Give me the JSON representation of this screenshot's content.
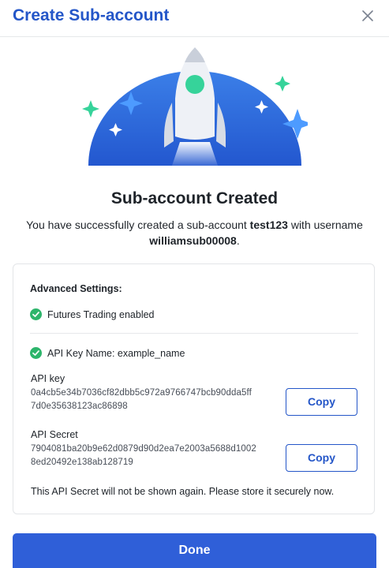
{
  "dialog": {
    "title": "Create Sub-account",
    "close_icon": "close-icon"
  },
  "hero": {
    "illustration": "rocket-launch",
    "colors": {
      "dome": "#2f6ee0",
      "rocket": "#eef1f6",
      "window": "#36d39a",
      "sparkle_teal": "#36d39a",
      "sparkle_blue": "#4d9bff"
    }
  },
  "result": {
    "heading": "Sub-account Created",
    "desc_prefix": "You have successfully created a sub-account ",
    "account_name": "test123",
    "desc_middle": " with username ",
    "username": "williamsub00008",
    "desc_suffix": "."
  },
  "settings": {
    "title": "Advanced Settings:",
    "futures": "Futures Trading enabled",
    "api_key_name": "API Key Name: example_name",
    "api_key_label": "API key",
    "api_key_line1": "0a4cb5e34b7036cf82dbb5c972a9766747bcb90dda5ff",
    "api_key_line2": "7d0e35638123ac86898",
    "api_secret_label": "API Secret",
    "api_secret_line1": "7904081ba20b9e62d0879d90d2ea7e2003a5688d1002",
    "api_secret_line2": "8ed20492e138ab128719",
    "copy_label": "Copy",
    "warning": "This API Secret will not be shown again. Please store it securely now."
  },
  "footer": {
    "done_label": "Done"
  },
  "colors": {
    "brand": "#2456c8",
    "button": "#2f5fd8",
    "success": "#2db56b"
  }
}
